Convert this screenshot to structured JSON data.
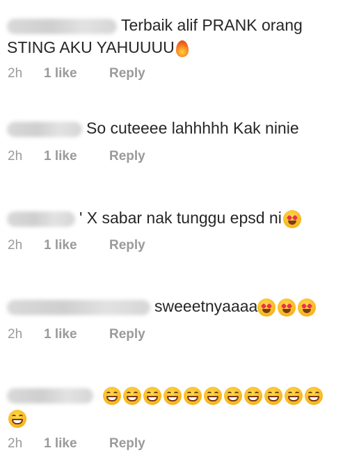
{
  "comments": [
    {
      "text_line1": "Terbaik alif PRANK orang",
      "text_line2": "STING AKU YAHUUUU",
      "emoji": "fire-icon",
      "time": "2h",
      "likes": "1 like",
      "reply": "Reply"
    },
    {
      "text": "So cuteeee lahhhhh Kak ninie",
      "time": "2h",
      "likes": "1 like",
      "reply": "Reply"
    },
    {
      "text": "' X sabar nak tunggu epsd ni",
      "emoji": "heart-eyes-icon",
      "time": "2h",
      "likes": "1 like",
      "reply": "Reply"
    },
    {
      "text": "sweeetnyaaaa",
      "emoji": "heart-eyes-icon",
      "emoji_count": 3,
      "time": "2h",
      "likes": "1 like",
      "reply": "Reply"
    },
    {
      "emoji": "grinning-face-icon",
      "emoji_count": 12,
      "time": "2h",
      "likes": "1 like",
      "reply": "Reply"
    }
  ]
}
